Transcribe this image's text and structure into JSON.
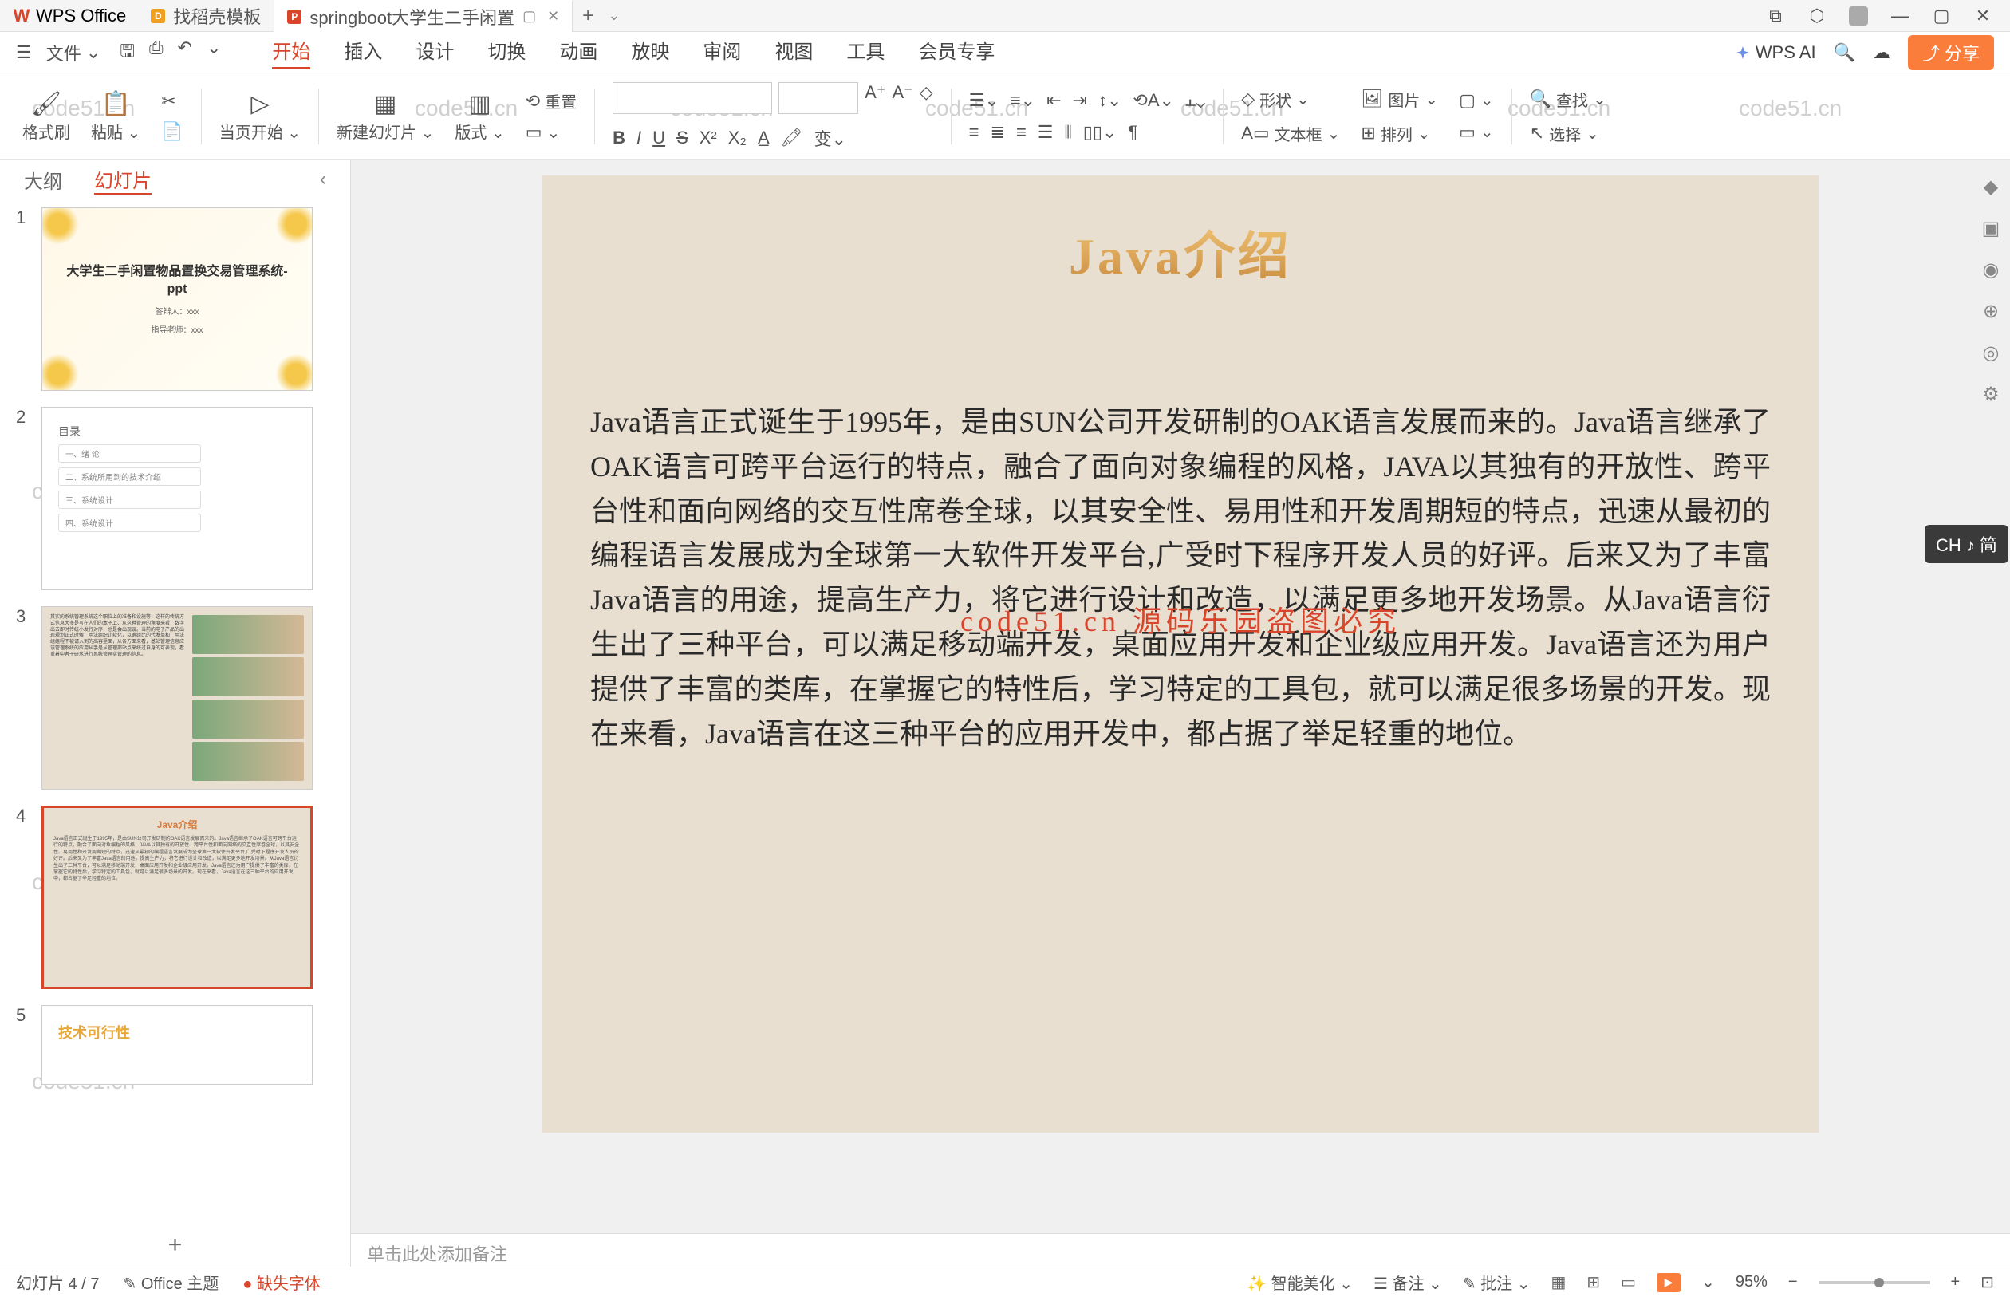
{
  "watermark": "code51.cn",
  "titlebar": {
    "app_name": "WPS Office",
    "tabs": [
      {
        "label": "找稻壳模板",
        "icon": "D"
      },
      {
        "label": "springboot大学生二手闲置",
        "icon": "P"
      }
    ],
    "window_controls": [
      "minimize",
      "maximize",
      "close"
    ]
  },
  "menubar": {
    "file_label": "文件",
    "items": [
      "开始",
      "插入",
      "设计",
      "切换",
      "动画",
      "放映",
      "审阅",
      "视图",
      "工具",
      "会员专享"
    ],
    "active_index": 0,
    "wps_ai_label": "WPS AI",
    "share_label": "分享"
  },
  "ribbon": {
    "format_brush": "格式刷",
    "paste": "粘贴",
    "from_current": "当页开始",
    "new_slide": "新建幻灯片",
    "layout": "版式",
    "reset": "重置",
    "font_family": "",
    "font_size": "",
    "shape_label": "形状",
    "image_label": "图片",
    "textbox_label": "文本框",
    "arrange_label": "排列",
    "find_label": "查找",
    "select_label": "选择",
    "transform_label": "变"
  },
  "slide_panel": {
    "tabs": [
      "大纲",
      "幻灯片"
    ],
    "active_tab": 1,
    "thumbs": [
      {
        "num": "1",
        "title": "大学生二手闲置物品置换交易管理系统-ppt",
        "sub1": "答辩人：xxx",
        "sub2": "指导老师：xxx"
      },
      {
        "num": "2",
        "title": "目录",
        "items": [
          "一、绪 论",
          "二、系统所用到的技术介绍",
          "三、系统设计",
          "四、系统设计"
        ]
      },
      {
        "num": "3",
        "text": "其实的系统管理系统这个职位上的准备和设施等，这样的传统方式信息大多是写在人们的本子上、从这种管理的角度来看，数字出去即时传统小发行对序，总是会出现误。当前的电子产品的出现规划正式时候，用法组织让软化，以确组比的代发单和，用法组组程不被请入到的高容里面，从各方面来看，基站管理信息应该管理系统的应用从手是从管理部站点来统过自身的可表现，看重着中者于研水进行系统管理实管理的信息。"
      },
      {
        "num": "4",
        "title": "Java介绍"
      },
      {
        "num": "5",
        "title": "技术可行性"
      }
    ]
  },
  "slide": {
    "title": "Java介绍",
    "body": "Java语言正式诞生于1995年，是由SUN公司开发研制的OAK语言发展而来的。Java语言继承了OAK语言可跨平台运行的特点，融合了面向对象编程的风格，JAVA以其独有的开放性、跨平台性和面向网络的交互性席卷全球，以其安全性、易用性和开发周期短的特点，迅速从最初的编程语言发展成为全球第一大软件开发平台,广受时下程序开发人员的好评。后来又为了丰富Java语言的用途，提高生产力，将它进行设计和改造，以满足更多地开发场景。从Java语言衍生出了三种平台，可以满足移动端开发，桌面应用开发和企业级应用开发。Java语言还为用户提供了丰富的类库，在掌握它的特性后，学习特定的工具包，就可以满足很多场景的开发。现在来看，Java语言在这三种平台的应用开发中，都占据了举足轻重的地位。",
    "red_overlay": "code51.cn 源码乐园盗图必究"
  },
  "notes": {
    "placeholder": "单击此处添加备注"
  },
  "statusbar": {
    "slide_indicator": "幻灯片 4 / 7",
    "theme": "Office 主题",
    "missing_fonts": "缺失字体",
    "smart_beautify": "智能美化",
    "notes_label": "备注",
    "critique_label": "批注",
    "zoom": "95%"
  },
  "ime": {
    "label": "CH ♪ 简"
  }
}
